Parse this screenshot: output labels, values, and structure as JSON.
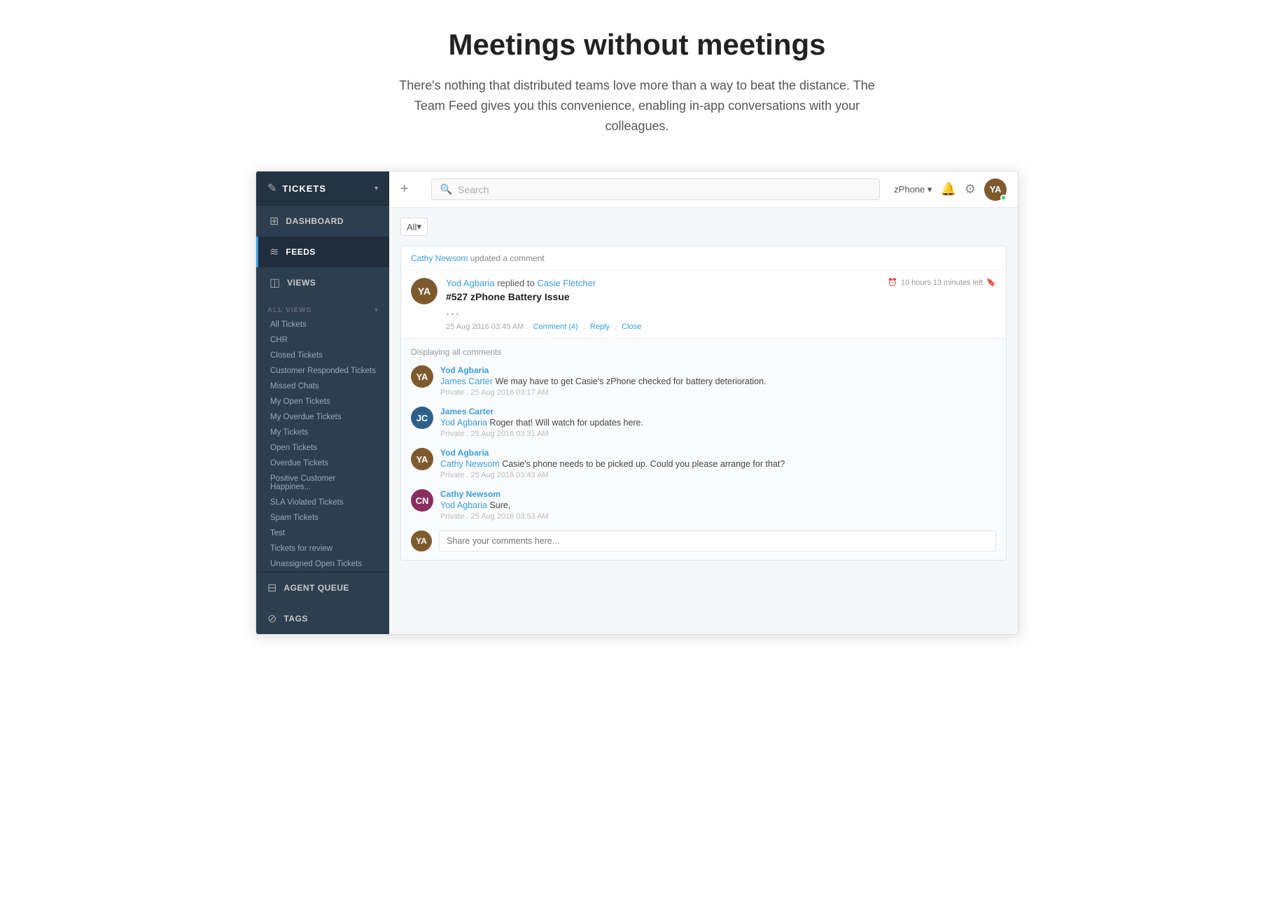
{
  "hero": {
    "title": "Meetings without meetings",
    "subtitle": "There's nothing that distributed teams love more than a way to beat the distance. The Team Feed gives you this convenience, enabling in-app conversations with your colleagues."
  },
  "sidebar": {
    "header": {
      "icon": "✎",
      "title": "TICKETS",
      "arrow": "▾"
    },
    "nav_items": [
      {
        "id": "dashboard",
        "icon": "⊞",
        "label": "DASHBOARD"
      },
      {
        "id": "feeds",
        "icon": "≋",
        "label": "FEEDS",
        "active": true
      },
      {
        "id": "views",
        "icon": "◫",
        "label": "VIEWS"
      }
    ],
    "section_label": "ALL VIEWS",
    "list_items": [
      "All Tickets",
      "CHR",
      "Closed Tickets",
      "Customer Responded Tickets",
      "Missed Chats",
      "My Open Tickets",
      "My Overdue Tickets",
      "My Tickets",
      "Open Tickets",
      "Overdue Tickets",
      "Positive Customer Happines...",
      "SLA Violated Tickets",
      "Spam Tickets",
      "Test",
      "Tickets for review",
      "Unassigned Open Tickets"
    ],
    "bottom_items": [
      {
        "id": "agent-queue",
        "icon": "⊟",
        "label": "AGENT QUEUE"
      },
      {
        "id": "tags",
        "icon": "⊘",
        "label": "TAGS"
      }
    ]
  },
  "topbar": {
    "add_icon": "+",
    "search_placeholder": "Search",
    "workspace": "zPhone",
    "workspace_arrow": "▾"
  },
  "feed": {
    "filter": "All",
    "filter_arrow": "▾",
    "updater_name": "Cathy Newsom",
    "update_action": "updated a comment",
    "ticket": {
      "author": "Yod Agbaria",
      "action": "replied to",
      "recipient": "Casie Fletcher",
      "time_left": "10 hours 13 minutes left",
      "subject": "#527 zPhone Battery Issue",
      "ellipsis": "...",
      "date": "25 Aug 2016 03:49 AM",
      "comment_count": "Comment (4)",
      "reply_label": "Reply",
      "close_label": "Close"
    },
    "comments_section": {
      "title": "Displaying all comments",
      "comments": [
        {
          "id": "c1",
          "author": "Yod Agbaria",
          "mention": "James Carter",
          "text": "We may have to get Casie's zPhone checked for battery deterioration.",
          "meta_privacy": "Private",
          "meta_date": "25 Aug 2016 03:17 AM",
          "avatar_class": "avatar-yod",
          "avatar_initials": "YA"
        },
        {
          "id": "c2",
          "author": "James Carter",
          "mention": "Yod Agbaria",
          "text": "Roger that! Will watch for updates here.",
          "meta_privacy": "Private",
          "meta_date": "25 Aug 2016 03:31 AM",
          "avatar_class": "avatar-james",
          "avatar_initials": "JC"
        },
        {
          "id": "c3",
          "author": "Yod Agbaria",
          "mention": "Cathy Newsom",
          "text": "Casie's phone needs to be picked up. Could you please arrange for that?",
          "meta_privacy": "Private",
          "meta_date": "25 Aug 2016 03:43 AM",
          "avatar_class": "avatar-yod",
          "avatar_initials": "YA"
        },
        {
          "id": "c4",
          "author": "Cathy Newsom",
          "mention": "Yod Agbaria",
          "text": "Sure,",
          "meta_privacy": "Private",
          "meta_date": "25 Aug 2016 03:53 AM",
          "avatar_class": "avatar-cathy",
          "avatar_initials": "CN"
        }
      ],
      "input_placeholder": "Share your comments here..."
    }
  }
}
